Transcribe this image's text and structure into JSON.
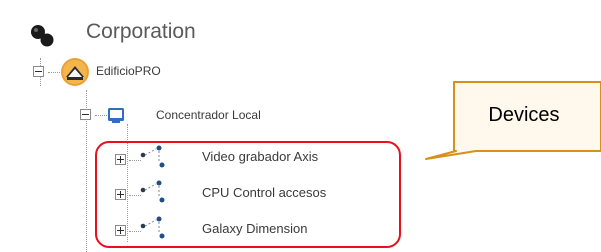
{
  "tree": {
    "root": {
      "label": "Corporation",
      "icon": "corporation-globe-icon"
    },
    "site": {
      "label": "EdificioPRO",
      "icon": "building-icon",
      "expanded": true
    },
    "concentrator": {
      "label": "Concentrador Local",
      "icon": "monitor-icon",
      "expanded": true
    },
    "devices": [
      {
        "label": "Video grabador Axis",
        "icon": "network-device-icon",
        "expanded": false
      },
      {
        "label": "CPU Control accesos",
        "icon": "network-device-icon",
        "expanded": false
      },
      {
        "label": "Galaxy Dimension",
        "icon": "network-device-icon",
        "expanded": false
      }
    ]
  },
  "annotation": {
    "callout_label": "Devices",
    "highlight_color": "#e8101f",
    "callout_border_color": "#d8901c"
  }
}
